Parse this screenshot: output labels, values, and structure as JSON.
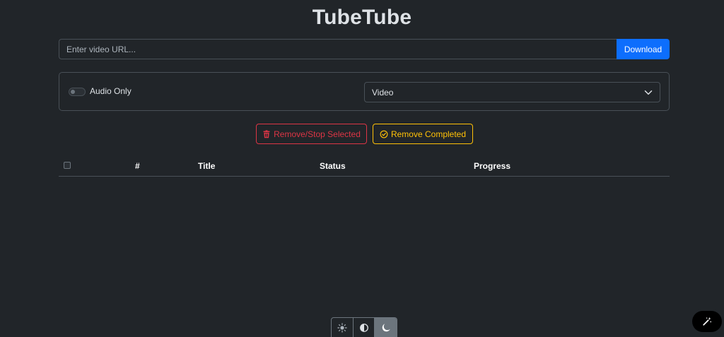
{
  "app": {
    "title": "TubeTube"
  },
  "url_bar": {
    "placeholder": "Enter video URL...",
    "value": "",
    "download_label": "Download"
  },
  "options": {
    "audio_only_label": "Audio Only",
    "audio_only_enabled": false,
    "format_selected": "Video"
  },
  "actions": {
    "remove_stop_label": "Remove/Stop Selected",
    "remove_completed_label": "Remove Completed"
  },
  "table": {
    "columns": [
      "#",
      "Title",
      "Status",
      "Progress"
    ],
    "rows": []
  },
  "theme_switcher": {
    "options": [
      "sun-icon",
      "circle-half-icon",
      "moon-icon"
    ],
    "active": "moon-icon"
  },
  "colors": {
    "background": "#212529",
    "primary": "#0d6efd",
    "danger": "#dc3545",
    "warning": "#ffc107",
    "border": "#495057"
  }
}
